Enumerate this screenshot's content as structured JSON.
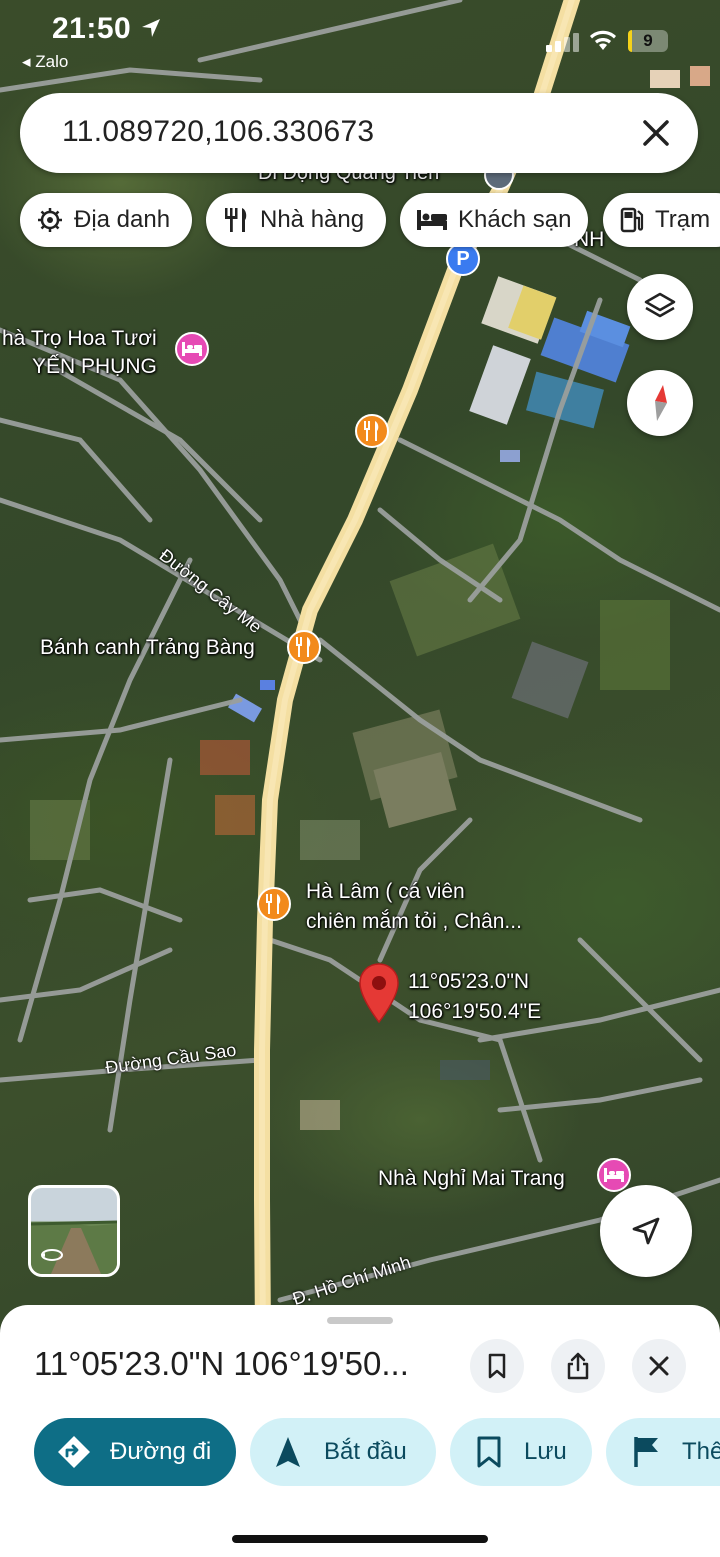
{
  "status_bar": {
    "time": "21:50",
    "back_app": "◂ Zalo",
    "battery": "9",
    "battery_percent": 9
  },
  "search": {
    "value": "11.089720,106.330673"
  },
  "chips": [
    {
      "label": "Địa danh",
      "icon": "landmark-icon"
    },
    {
      "label": "Nhà hàng",
      "icon": "restaurant-icon"
    },
    {
      "label": "Khách sạn",
      "icon": "hotel-icon"
    },
    {
      "label": "Trạm",
      "icon": "gas-station-icon"
    }
  ],
  "map": {
    "labels": {
      "di_dong": "Di Động Quang Tiến",
      "nha_tro": "hà Trọ Hoa Tươi",
      "yen_phung": "YẾN PHỤNG",
      "banh_canh": "Bánh canh Trảng Bàng",
      "ha_lam_1": "Hà Lâm ( cá viên",
      "ha_lam_2": "chiên mắm tỏi , Chân...",
      "pin_lat": "11°05'23.0\"N",
      "pin_lng": "106°19'50.4\"E",
      "nha_nghi": "Nhà Nghỉ Mai Trang",
      "street_cay_me": "Đường Cây Me",
      "street_cau_sao": "Đường Cầu Sao",
      "street_hcm": "Đ. Hồ Chí Minh",
      "partial_right": "NH"
    }
  },
  "sheet": {
    "title": "11°05'23.0\"N 106°19'50...",
    "actions": [
      {
        "label": "Đường đi",
        "icon": "directions-icon"
      },
      {
        "label": "Bắt đầu",
        "icon": "navigation-arrow-icon"
      },
      {
        "label": "Lưu",
        "icon": "bookmark-icon"
      },
      {
        "label": "Thê",
        "icon": "flag-icon"
      }
    ]
  },
  "colors": {
    "primary_action": "#0e6e86",
    "secondary_action": "#d2f1f7",
    "food_poi": "#f28a1c",
    "hotel_poi": "#e64ab4",
    "pin": "#e53935",
    "highway": "#f4dfa2"
  }
}
